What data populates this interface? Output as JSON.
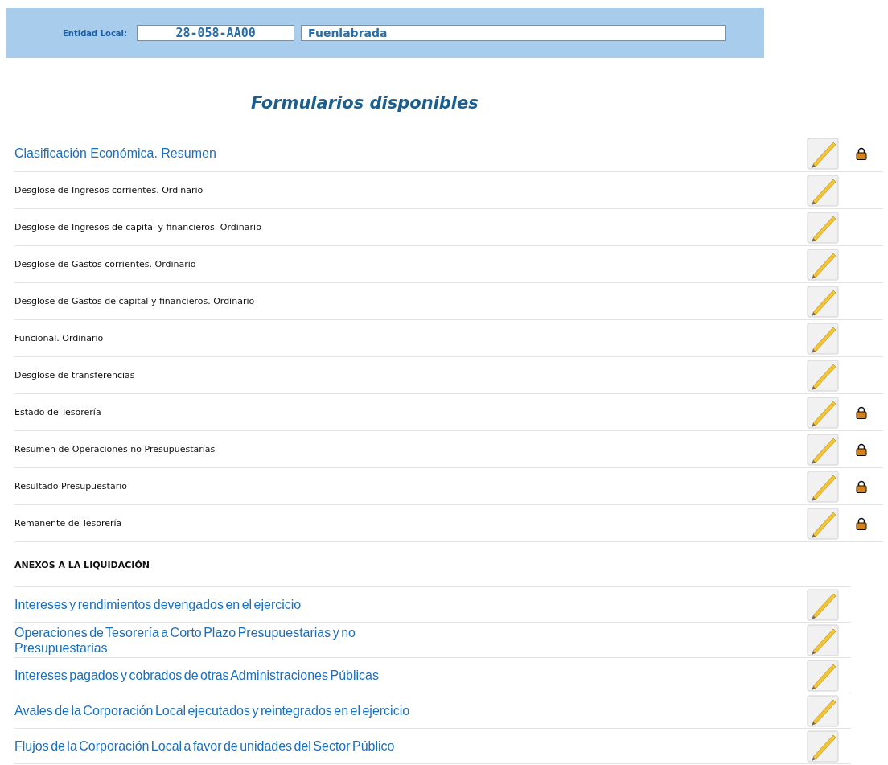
{
  "header": {
    "label": "Entidad Local:",
    "code": "28-058-AA00",
    "name": "Fuenlabrada"
  },
  "title": "Formularios disponibles",
  "forms": [
    {
      "label": "Clasificación Económica. Resumen",
      "kind": "link",
      "locked": true
    },
    {
      "label": "Desglose de Ingresos corrientes. Ordinario",
      "kind": "plain",
      "locked": false
    },
    {
      "label": "Desglose de Ingresos de capital y financieros. Ordinario",
      "kind": "plain",
      "locked": false
    },
    {
      "label": "Desglose de Gastos corrientes. Ordinario",
      "kind": "plain",
      "locked": false
    },
    {
      "label": "Desglose de Gastos de capital y financieros. Ordinario",
      "kind": "plain",
      "locked": false
    },
    {
      "label": "Funcional. Ordinario",
      "kind": "plain",
      "locked": false
    },
    {
      "label": "Desglose de transferencias",
      "kind": "plain",
      "locked": false
    },
    {
      "label": "Estado de Tesorería",
      "kind": "plain",
      "locked": true
    },
    {
      "label": "Resumen de Operaciones no Presupuestarias",
      "kind": "plain",
      "locked": true
    },
    {
      "label": "Resultado Presupuestario",
      "kind": "plain",
      "locked": true
    },
    {
      "label": "Remanente de Tesorería",
      "kind": "plain",
      "locked": true
    }
  ],
  "annex": {
    "heading": "ANEXOS A LA LIQUIDACIÓN",
    "forms": [
      {
        "label": "Intereses y rendimientos devengados en el ejercicio",
        "kind": "link"
      },
      {
        "label": "Operaciones de Tesorería a Corto Plazo Presupuestarias y no Presupuestarias",
        "kind": "link"
      },
      {
        "label": "Intereses pagados y cobrados de otras Administraciones Públicas",
        "kind": "link"
      },
      {
        "label": "Avales de la Corporación Local ejecutados y reintegrados en el ejercicio",
        "kind": "link"
      },
      {
        "label": "Flujos de la Corporación Local a favor de unidades del Sector Público",
        "kind": "link"
      }
    ]
  }
}
